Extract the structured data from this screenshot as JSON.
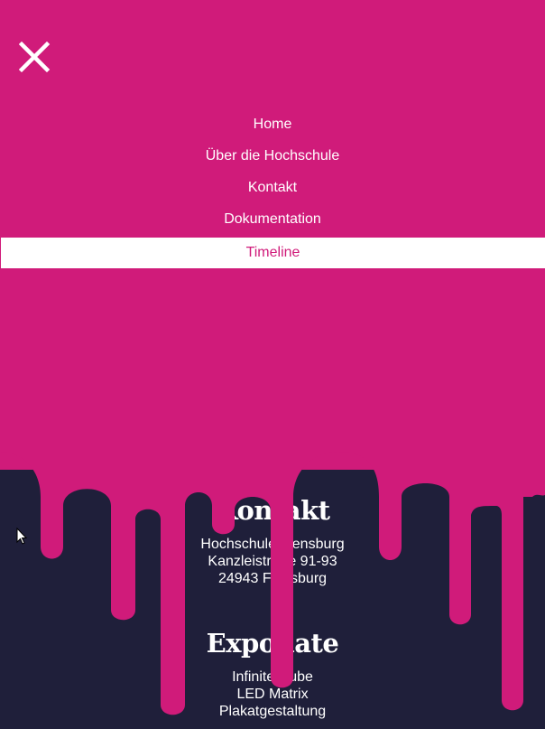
{
  "colors": {
    "accent": "#d01b7a",
    "dark": "#1f1f3a",
    "white": "#ffffff"
  },
  "menu": {
    "close_icon": "close-icon",
    "items": [
      {
        "label": "Home"
      },
      {
        "label": "Über die Hochschule"
      },
      {
        "label": "Kontakt"
      },
      {
        "label": "Dokumentation"
      },
      {
        "label": "Timeline",
        "active": true
      }
    ]
  },
  "footer": {
    "contact": {
      "heading": "Kontakt",
      "lines": [
        "Hochschule Flensburg",
        "Kanzleistraße 91-93",
        "24943 Flensburg"
      ]
    },
    "exhibits": {
      "heading": "Exponate",
      "items": [
        "Infinite Cube",
        "LED Matrix",
        "Plakatgestaltung"
      ]
    }
  }
}
